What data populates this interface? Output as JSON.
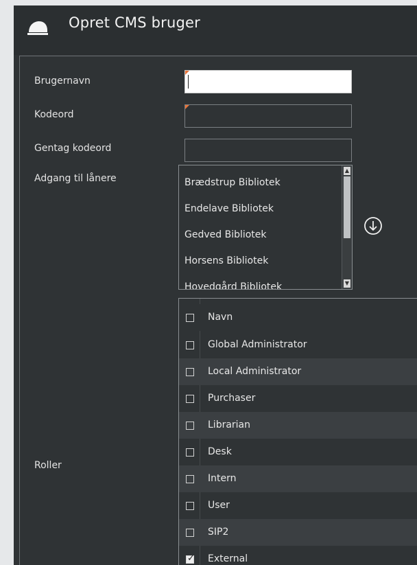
{
  "window": {
    "title": "Opret CMS bruger",
    "icon": "helmet-icon"
  },
  "form": {
    "username_label": "Brugernavn",
    "username_value": "",
    "password_label": "Kodeord",
    "password_value": "",
    "repeat_password_label": "Gentag kodeord",
    "repeat_password_value": "",
    "access_label": "Adgang til lånere",
    "roles_label": "Roller"
  },
  "libraries": {
    "items": [
      "Brædstrup Bibliotek",
      "Endelave Bibliotek",
      "Gedved Bibliotek",
      "Horsens Bibliotek",
      "Hovedgård Bibliotek"
    ],
    "add_icon": "arrow-down-circle-icon"
  },
  "roles": {
    "header": "Navn",
    "rows": [
      {
        "name": "Global Administrator",
        "checked": false
      },
      {
        "name": "Local Administrator",
        "checked": false
      },
      {
        "name": "Purchaser",
        "checked": false
      },
      {
        "name": "Librarian",
        "checked": false
      },
      {
        "name": "Desk",
        "checked": false
      },
      {
        "name": "Intern",
        "checked": false
      },
      {
        "name": "User",
        "checked": false
      },
      {
        "name": "SIP2",
        "checked": false
      },
      {
        "name": "External",
        "checked": true
      }
    ]
  },
  "colors": {
    "background": "#2f3335",
    "accent_marker": "#e8743a"
  }
}
